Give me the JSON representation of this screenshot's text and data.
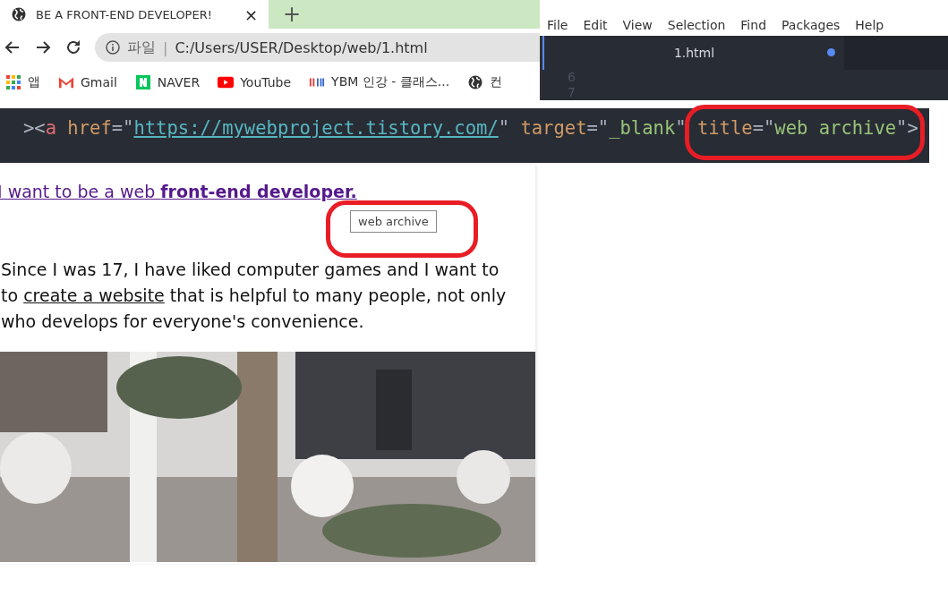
{
  "browser": {
    "tab": {
      "title": "BE A FRONT-END DEVELOPER!",
      "close": "×"
    },
    "new_tab": "+",
    "address": {
      "scheme": "파일",
      "separator": "|",
      "url": "C:/Users/USER/Desktop/web/1.html"
    },
    "bookmarks": [
      {
        "label": "앱",
        "kind": "apps"
      },
      {
        "label": "Gmail",
        "kind": "gmail"
      },
      {
        "label": "NAVER",
        "kind": "naver"
      },
      {
        "label": "YouTube",
        "kind": "youtube"
      },
      {
        "label": "YBM 인강 - 클래스...",
        "kind": "ybm"
      },
      {
        "label": "컨",
        "kind": "globe"
      }
    ]
  },
  "editor": {
    "menu": [
      "File",
      "Edit",
      "View",
      "Selection",
      "Find",
      "Packages",
      "Help"
    ],
    "tab": {
      "title": "1.html",
      "modified": true
    },
    "line_numbers": [
      "6",
      "7"
    ]
  },
  "code_strip": {
    "lines": [
      [
        {
          "t": "><",
          "kind": "punct"
        },
        {
          "t": "a",
          "kind": "tag"
        },
        {
          "t": " href",
          "kind": "attr"
        },
        {
          "t": "=\"",
          "kind": "punct"
        },
        {
          "t": "https://mywebproject.tistory.com/",
          "kind": "link"
        },
        {
          "t": "\"",
          "kind": "punct"
        },
        {
          "t": " target",
          "kind": "attr"
        },
        {
          "t": "=\"",
          "kind": "punct"
        },
        {
          "t": "_blank",
          "kind": "str"
        },
        {
          "t": "\"",
          "kind": "punct"
        },
        {
          "t": " title",
          "kind": "attr"
        },
        {
          "t": "=\"",
          "kind": "punct"
        },
        {
          "t": "web archive",
          "kind": "str"
        },
        {
          "t": "\">",
          "kind": "punct"
        }
      ]
    ]
  },
  "page": {
    "heading_link": "I want to be a web **front-end developer.**",
    "tooltip": "web archive",
    "paragraph": [
      "Since I was 17, I have liked computer games and I want to ",
      "to",
      "create a website",
      " that is helpful to many people, not only ",
      "who develops for everyone's convenience."
    ],
    "photo": {
      "kind": "picture"
    }
  }
}
